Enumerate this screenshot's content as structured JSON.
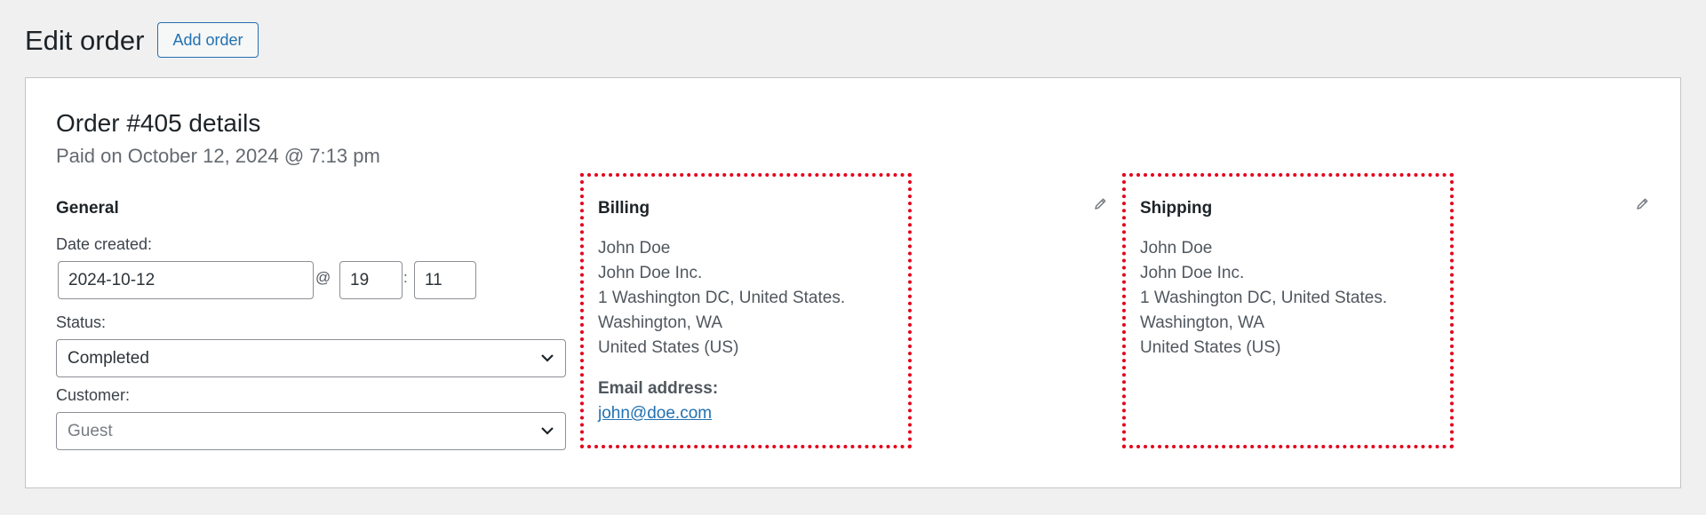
{
  "header": {
    "title": "Edit order",
    "add_order_label": "Add order"
  },
  "order": {
    "title": "Order #405 details",
    "subtitle": "Paid on October 12, 2024 @ 7:13 pm"
  },
  "general": {
    "heading": "General",
    "date_label": "Date created:",
    "date_value": "2024-10-12",
    "at_sep": "@",
    "hour_value": "19",
    "colon_sep": ":",
    "minute_value": "11",
    "status_label": "Status:",
    "status_value": "Completed",
    "customer_label": "Customer:",
    "customer_value": "Guest"
  },
  "billing": {
    "heading": "Billing",
    "lines": [
      "John Doe",
      "John Doe Inc.",
      "1 Washington DC, United States.",
      "Washington, WA",
      "United States (US)"
    ],
    "email_label": "Email address:",
    "email": "john@doe.com"
  },
  "shipping": {
    "heading": "Shipping",
    "lines": [
      "John Doe",
      "John Doe Inc.",
      "1 Washington DC, United States.",
      "Washington, WA",
      "United States (US)"
    ]
  },
  "icons": {
    "edit": "pencil-icon",
    "dropdown": "chevron-down-icon"
  },
  "colors": {
    "accent": "#2271b1",
    "highlight": "#e3001b",
    "background": "#f0f0f1"
  }
}
